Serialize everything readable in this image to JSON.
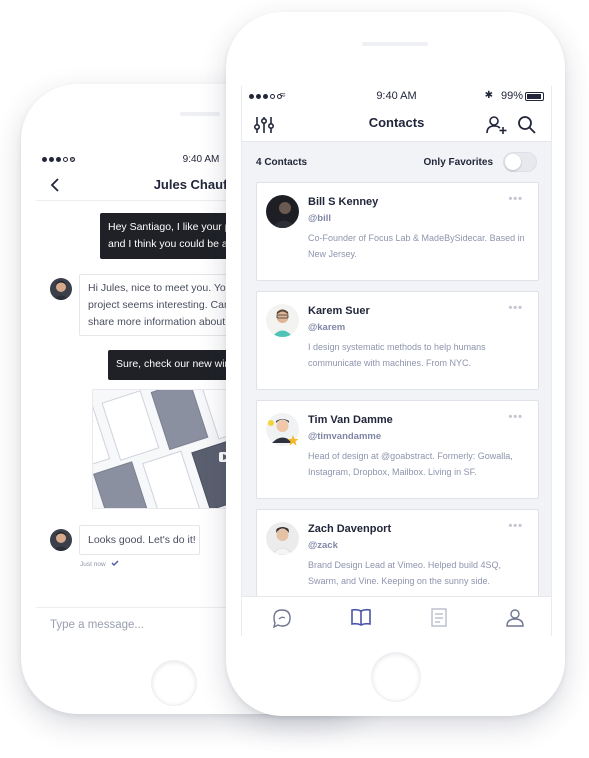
{
  "chat": {
    "status_time": "9:40 AM",
    "title": "Jules Chaufour",
    "messages": [
      {
        "from": "me",
        "text_line1": "Hey Santiago, I like your portfolio",
        "text_line2": "and I think you could be a good fit."
      },
      {
        "from": "them",
        "text_line1": "Hi Jules, nice to meet you. Your",
        "text_line2": "project seems interesting. Can you",
        "text_line3": "share more information about it?"
      },
      {
        "from": "me",
        "text_line1": "Sure, check our new wireframes!"
      },
      {
        "from": "them",
        "text_line1": "Looks good. Let's do it!"
      }
    ],
    "timestamp": "Just now",
    "input_placeholder": "Type a message..."
  },
  "contacts": {
    "status_time": "9:40 AM",
    "battery": "99%",
    "title": "Contacts",
    "count_label": "4 Contacts",
    "favorites_label": "Only Favorites",
    "favorites_on": false,
    "more_glyph": "•••",
    "list": [
      {
        "name": "Bill S Kenney",
        "handle": "@bill",
        "bio": "Co-Founder of Focus Lab & MadeBySidecar. Based in New Jersey."
      },
      {
        "name": "Karem Suer",
        "handle": "@karem",
        "bio": "I design systematic methods to help humans communicate with machines. From NYC."
      },
      {
        "name": "Tim Van Damme",
        "handle": "@timvandamme",
        "bio": "Head of design at @goabstract. Formerly: Gowalla, Instagram, Dropbox, Mailbox. Living in SF."
      },
      {
        "name": "Zach Davenport",
        "handle": "@zack",
        "bio": "Brand Design Lead at Vimeo. Helped build 4SQ, Swarm, and Vine. Keeping on the sunny side."
      }
    ],
    "tabs": [
      "chat-tab",
      "contacts-tab",
      "notes-tab",
      "profile-tab"
    ],
    "active_tab": "contacts-tab"
  },
  "colors": {
    "accent": "#4b55a8",
    "handle": "#7f86a6",
    "bubble_dark": "#1f2126"
  }
}
